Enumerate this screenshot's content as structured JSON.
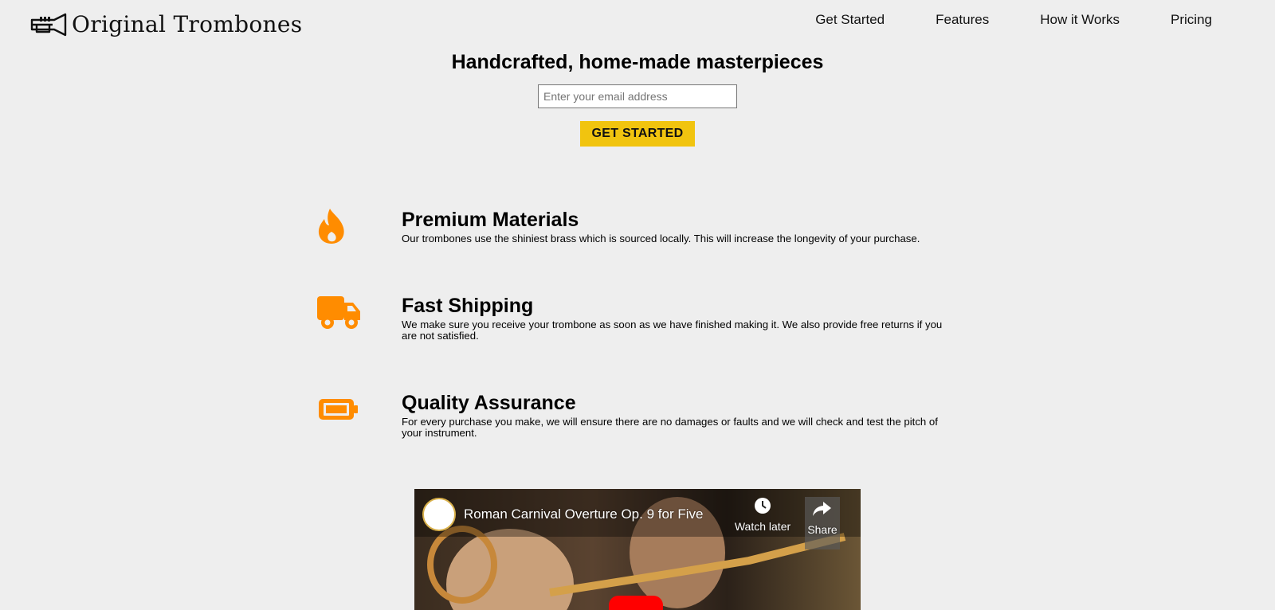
{
  "brand": {
    "name": "Original Trombones",
    "logo_icon": "trombone-icon"
  },
  "nav": {
    "items": [
      {
        "label": "Get Started"
      },
      {
        "label": "Features"
      },
      {
        "label": "How it Works"
      },
      {
        "label": "Pricing"
      }
    ]
  },
  "hero": {
    "title": "Handcrafted, home-made masterpieces",
    "email_placeholder": "Enter your email address",
    "cta_label": "GET STARTED"
  },
  "features": [
    {
      "icon": "fire-icon",
      "title": "Premium Materials",
      "description": "Our trombones use the shiniest brass which is sourced locally. This will increase the longevity of your purchase."
    },
    {
      "icon": "truck-icon",
      "title": "Fast Shipping",
      "description": "We make sure you receive your trombone as soon as we have finished making it. We also provide free returns if you are not satisfied."
    },
    {
      "icon": "battery-icon",
      "title": "Quality Assurance",
      "description": "For every purchase you make, we will ensure there are no damages or faults and we will check and test the pitch of your instrument."
    }
  ],
  "video": {
    "title": "Roman Carnival Overture Op. 9 for Five ...",
    "watch_later_label": "Watch later",
    "share_label": "Share"
  },
  "colors": {
    "accent": "#f1c40f",
    "icon": "#ff8c00",
    "background": "#eeeeee"
  }
}
